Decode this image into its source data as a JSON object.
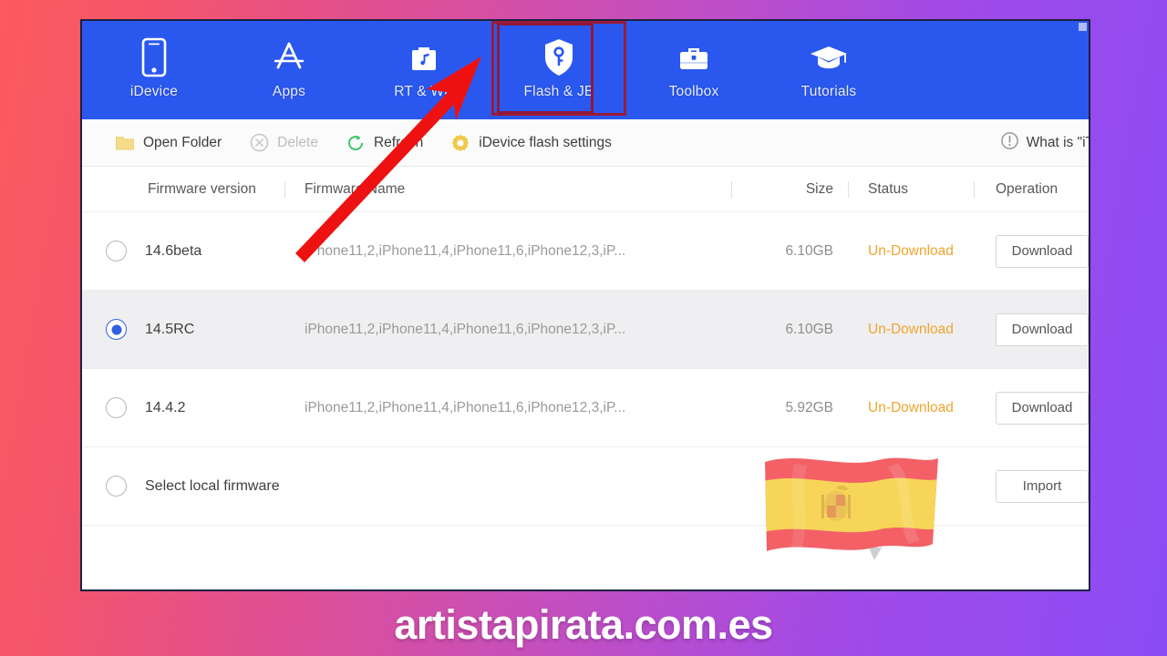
{
  "window": {
    "accent_blue": "#2a58ef",
    "highlight_border": "#90183a",
    "status_orange": "#f0a52e"
  },
  "nav": {
    "items": [
      {
        "label": "iDevice",
        "icon": "phone-icon",
        "selected": false
      },
      {
        "label": "Apps",
        "icon": "appstore-icon",
        "selected": false
      },
      {
        "label": "RT & WP",
        "icon": "music-bag-icon",
        "selected": false
      },
      {
        "label": "Flash & JB",
        "icon": "shield-key-icon",
        "selected": true
      },
      {
        "label": "Toolbox",
        "icon": "toolbox-icon",
        "selected": false
      },
      {
        "label": "Tutorials",
        "icon": "graduation-cap-icon",
        "selected": false
      }
    ]
  },
  "toolbar": {
    "open_folder": "Open Folder",
    "delete": "Delete",
    "refresh": "Refresh",
    "flash_settings": "iDevice flash settings",
    "help": "What is \"iT"
  },
  "table": {
    "headers": {
      "version": "Firmware version",
      "name": "Firmware Name",
      "size": "Size",
      "status": "Status",
      "operation": "Operation"
    },
    "rows": [
      {
        "version": "14.6beta",
        "name": "iPhone11,2,iPhone11,4,iPhone11,6,iPhone12,3,iP...",
        "size": "6.10GB",
        "status": "Un-Download",
        "action": "Download",
        "selected": false
      },
      {
        "version": "14.5RC",
        "name": "iPhone11,2,iPhone11,4,iPhone11,6,iPhone12,3,iP...",
        "size": "6.10GB",
        "status": "Un-Download",
        "action": "Download",
        "selected": true
      },
      {
        "version": "14.4.2",
        "name": "iPhone11,2,iPhone11,4,iPhone11,6,iPhone12,3,iP...",
        "size": "5.92GB",
        "status": "Un-Download",
        "action": "Download",
        "selected": false
      }
    ],
    "local_row": {
      "label": "Select local firmware",
      "action": "Import",
      "selected": false
    }
  },
  "watermark": {
    "site": "artistapirata.com.es",
    "flag": "spain-flag"
  }
}
